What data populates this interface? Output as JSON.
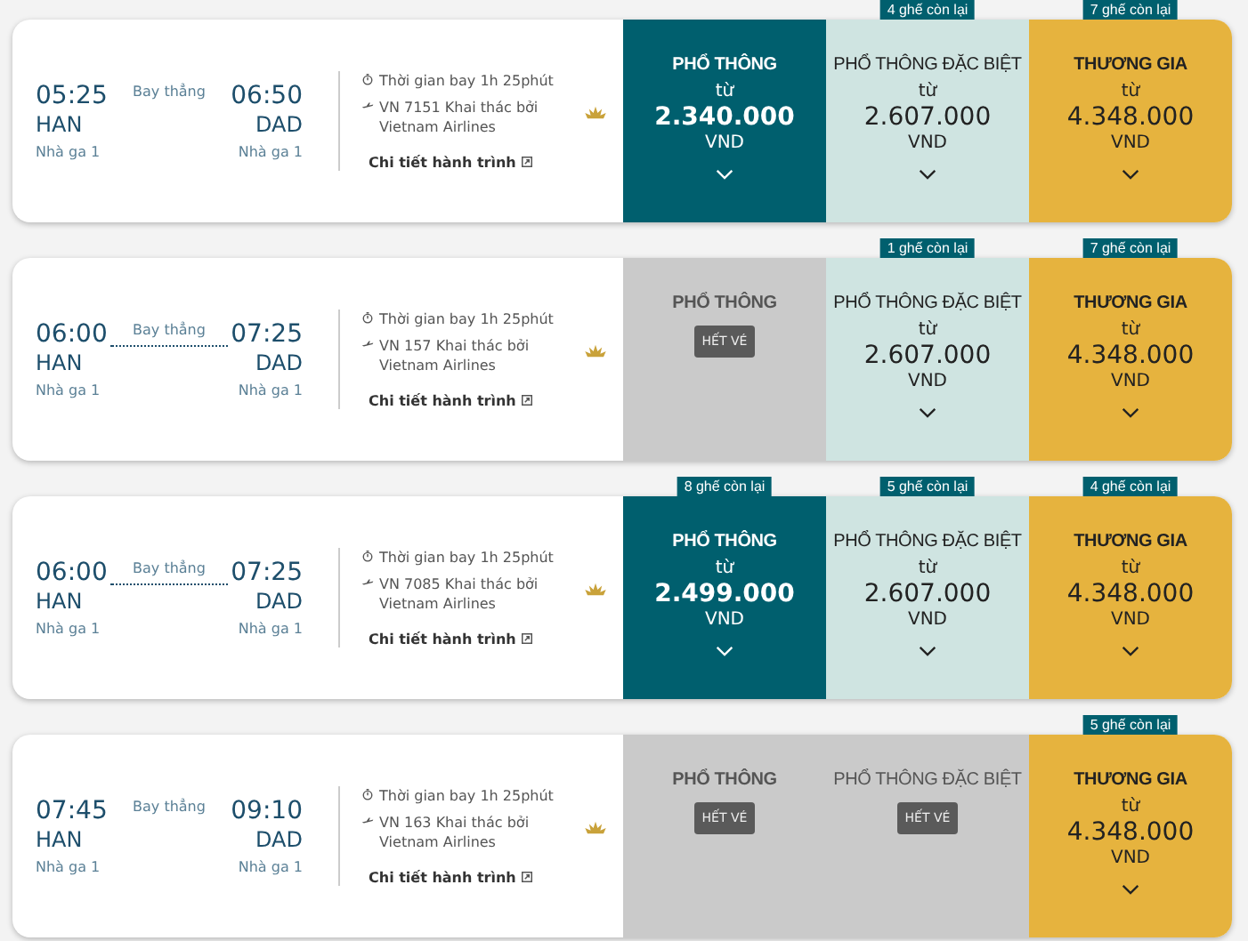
{
  "flights": [
    {
      "dep_time": "05:25",
      "dep_code": "HAN",
      "dep_terminal": "Nhà ga 1",
      "route": "Bay thẳng",
      "route_line": false,
      "arr_time": "06:50",
      "arr_code": "DAD",
      "arr_terminal": "Nhà ga 1",
      "duration": "Thời gian bay 1h 25phút",
      "operator": "VN 7151 Khai thác bởi Vietnam Airlines",
      "details": "Chi tiết hành trình",
      "fares": [
        {
          "kind": "economy",
          "label": "PHỔ THÔNG",
          "sold_out": false,
          "from": "từ",
          "price": "2.340.000",
          "currency": "VND"
        },
        {
          "kind": "premium",
          "label": "PHỔ THÔNG ĐẶC BIỆT",
          "sold_out": false,
          "seats": "4 ghế còn lại",
          "from": "từ",
          "price": "2.607.000",
          "currency": "VND"
        },
        {
          "kind": "business",
          "label": "THƯƠNG GIA",
          "sold_out": false,
          "seats": "7 ghế còn lại",
          "from": "từ",
          "price": "4.348.000",
          "currency": "VND"
        }
      ]
    },
    {
      "dep_time": "06:00",
      "dep_code": "HAN",
      "dep_terminal": "Nhà ga 1",
      "route": "Bay thẳng",
      "route_line": true,
      "arr_time": "07:25",
      "arr_code": "DAD",
      "arr_terminal": "Nhà ga 1",
      "duration": "Thời gian bay 1h 25phút",
      "operator": "VN 157 Khai thác bởi Vietnam Airlines",
      "details": "Chi tiết hành trình",
      "fares": [
        {
          "kind": "economy",
          "label": "PHỔ THÔNG",
          "sold_out": true,
          "status": "HẾT VÉ"
        },
        {
          "kind": "premium",
          "label": "PHỔ THÔNG ĐẶC BIỆT",
          "sold_out": false,
          "seats": "1 ghế còn lại",
          "from": "từ",
          "price": "2.607.000",
          "currency": "VND"
        },
        {
          "kind": "business",
          "label": "THƯƠNG GIA",
          "sold_out": false,
          "seats": "7 ghế còn lại",
          "from": "từ",
          "price": "4.348.000",
          "currency": "VND"
        }
      ]
    },
    {
      "dep_time": "06:00",
      "dep_code": "HAN",
      "dep_terminal": "Nhà ga 1",
      "route": "Bay thẳng",
      "route_line": true,
      "arr_time": "07:25",
      "arr_code": "DAD",
      "arr_terminal": "Nhà ga 1",
      "duration": "Thời gian bay 1h 25phút",
      "operator": "VN 7085 Khai thác bởi Vietnam Airlines",
      "details": "Chi tiết hành trình",
      "fares": [
        {
          "kind": "economy",
          "label": "PHỔ THÔNG",
          "sold_out": false,
          "seats": "8 ghế còn lại",
          "from": "từ",
          "price": "2.499.000",
          "currency": "VND"
        },
        {
          "kind": "premium",
          "label": "PHỔ THÔNG ĐẶC BIỆT",
          "sold_out": false,
          "seats": "5 ghế còn lại",
          "from": "từ",
          "price": "2.607.000",
          "currency": "VND"
        },
        {
          "kind": "business",
          "label": "THƯƠNG GIA",
          "sold_out": false,
          "seats": "4 ghế còn lại",
          "from": "từ",
          "price": "4.348.000",
          "currency": "VND"
        }
      ]
    },
    {
      "dep_time": "07:45",
      "dep_code": "HAN",
      "dep_terminal": "Nhà ga 1",
      "route": "Bay thẳng",
      "route_line": false,
      "arr_time": "09:10",
      "arr_code": "DAD",
      "arr_terminal": "Nhà ga 1",
      "duration": "Thời gian bay 1h 25phút",
      "operator": "VN 163 Khai thác bởi Vietnam Airlines",
      "details": "Chi tiết hành trình",
      "fares": [
        {
          "kind": "economy",
          "label": "PHỔ THÔNG",
          "sold_out": true,
          "status": "HẾT VÉ"
        },
        {
          "kind": "premium",
          "label": "PHỔ THÔNG ĐẶC BIỆT",
          "sold_out": true,
          "status": "HẾT VÉ"
        },
        {
          "kind": "business",
          "label": "THƯƠNG GIA",
          "sold_out": false,
          "seats": "5 ghế còn lại",
          "from": "từ",
          "price": "4.348.000",
          "currency": "VND"
        }
      ]
    }
  ]
}
